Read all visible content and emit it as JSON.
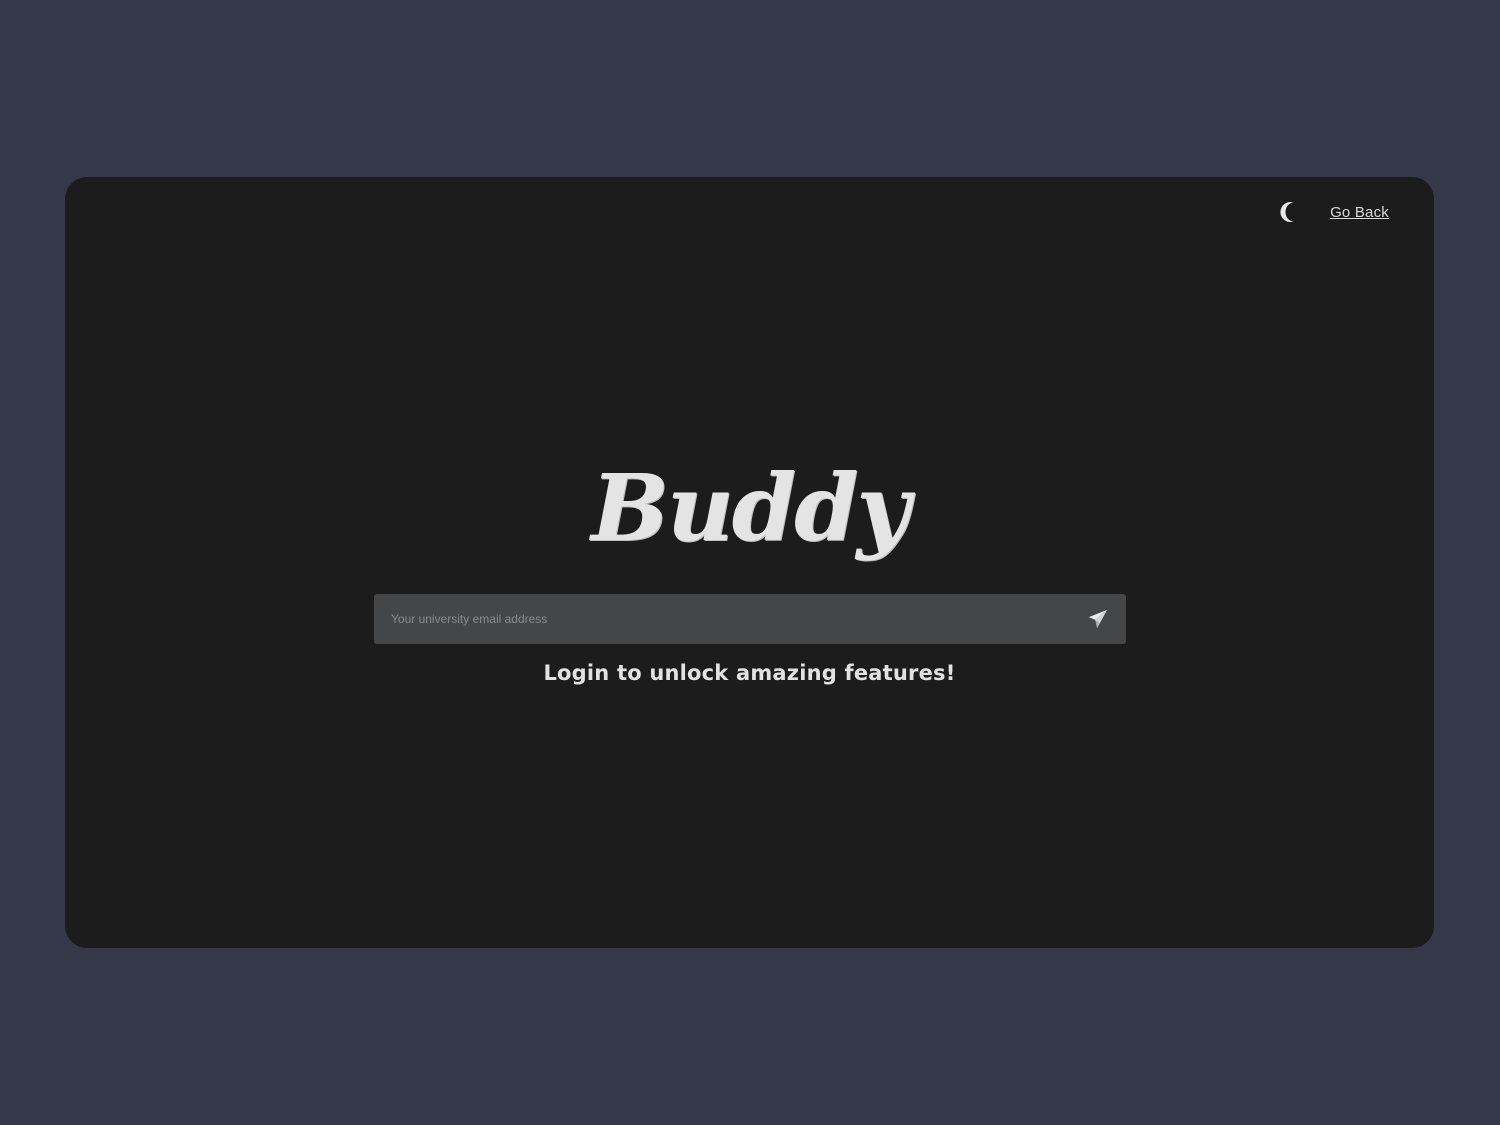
{
  "header": {
    "theme_toggle_icon": "moon-icon",
    "go_back_label": "Go Back"
  },
  "brand": {
    "logo_text": "Buddy"
  },
  "login": {
    "email_placeholder": "Your university email address",
    "email_value": "",
    "send_icon": "paper-plane-icon",
    "tagline": "Login to unlock amazing features!"
  },
  "colors": {
    "page_background": "#353849",
    "panel_background": "#1c1c1c",
    "input_background": "#454648",
    "text_primary": "#e2e2e2"
  }
}
